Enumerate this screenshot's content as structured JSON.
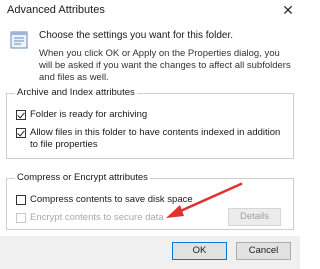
{
  "window": {
    "title": "Advanced Attributes",
    "close_glyph": "✕"
  },
  "intro": {
    "heading": "Choose the settings you want for this folder.",
    "body": "When you click OK or Apply on the Properties dialog, you will be asked if you want the changes to affect all subfolders and files as well.",
    "icon": "folder-attributes-icon"
  },
  "archive_group": {
    "legend": "Archive and Index attributes",
    "folder_ready": {
      "label": "Folder is ready for archiving",
      "checked": true
    },
    "allow_index": {
      "label": "Allow files in this folder to have contents indexed in addition to file properties",
      "checked": true
    }
  },
  "compress_group": {
    "legend": "Compress or Encrypt attributes",
    "compress": {
      "label": "Compress contents to save disk space",
      "checked": false
    },
    "encrypt": {
      "label": "Encrypt contents to secure data",
      "checked": false,
      "disabled": true
    },
    "details_label": "Details"
  },
  "buttons": {
    "ok_label": "OK",
    "cancel_label": "Cancel"
  },
  "annotation": {
    "arrow_color": "#e03030"
  }
}
